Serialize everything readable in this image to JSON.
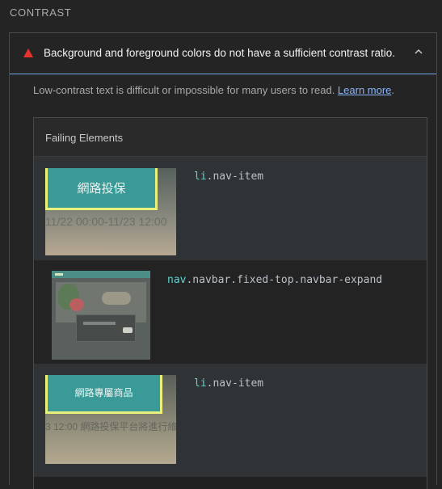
{
  "section": {
    "title": "CONTRAST"
  },
  "audit": {
    "title": "Background and foreground colors do not have a sufficient contrast ratio.",
    "description_prefix": "Low-contrast text is difficult or impossible for many users to read. ",
    "learn_more": "Learn more",
    "description_suffix": "."
  },
  "table": {
    "header": "Failing Elements",
    "rows": [
      {
        "node_tag": "li",
        "node_classes": ".nav-item",
        "thumb_button": "網路投保",
        "thumb_strip": "11/22 00:00-11/23 12:00"
      },
      {
        "node_tag": "nav",
        "node_classes": ".navbar.fixed-top.navbar-expand"
      },
      {
        "node_tag": "li",
        "node_classes": ".nav-item",
        "thumb_button": "網路專屬商品",
        "thumb_strip": "3 12:00 網路投保平台將進行維"
      }
    ]
  },
  "colors": {
    "fail": "#e5322d",
    "link": "#8ab4f8",
    "node_tag": "#5fd4d0"
  },
  "icons": {
    "fail": "warning-triangle-icon",
    "collapse": "chevron-up-icon"
  }
}
